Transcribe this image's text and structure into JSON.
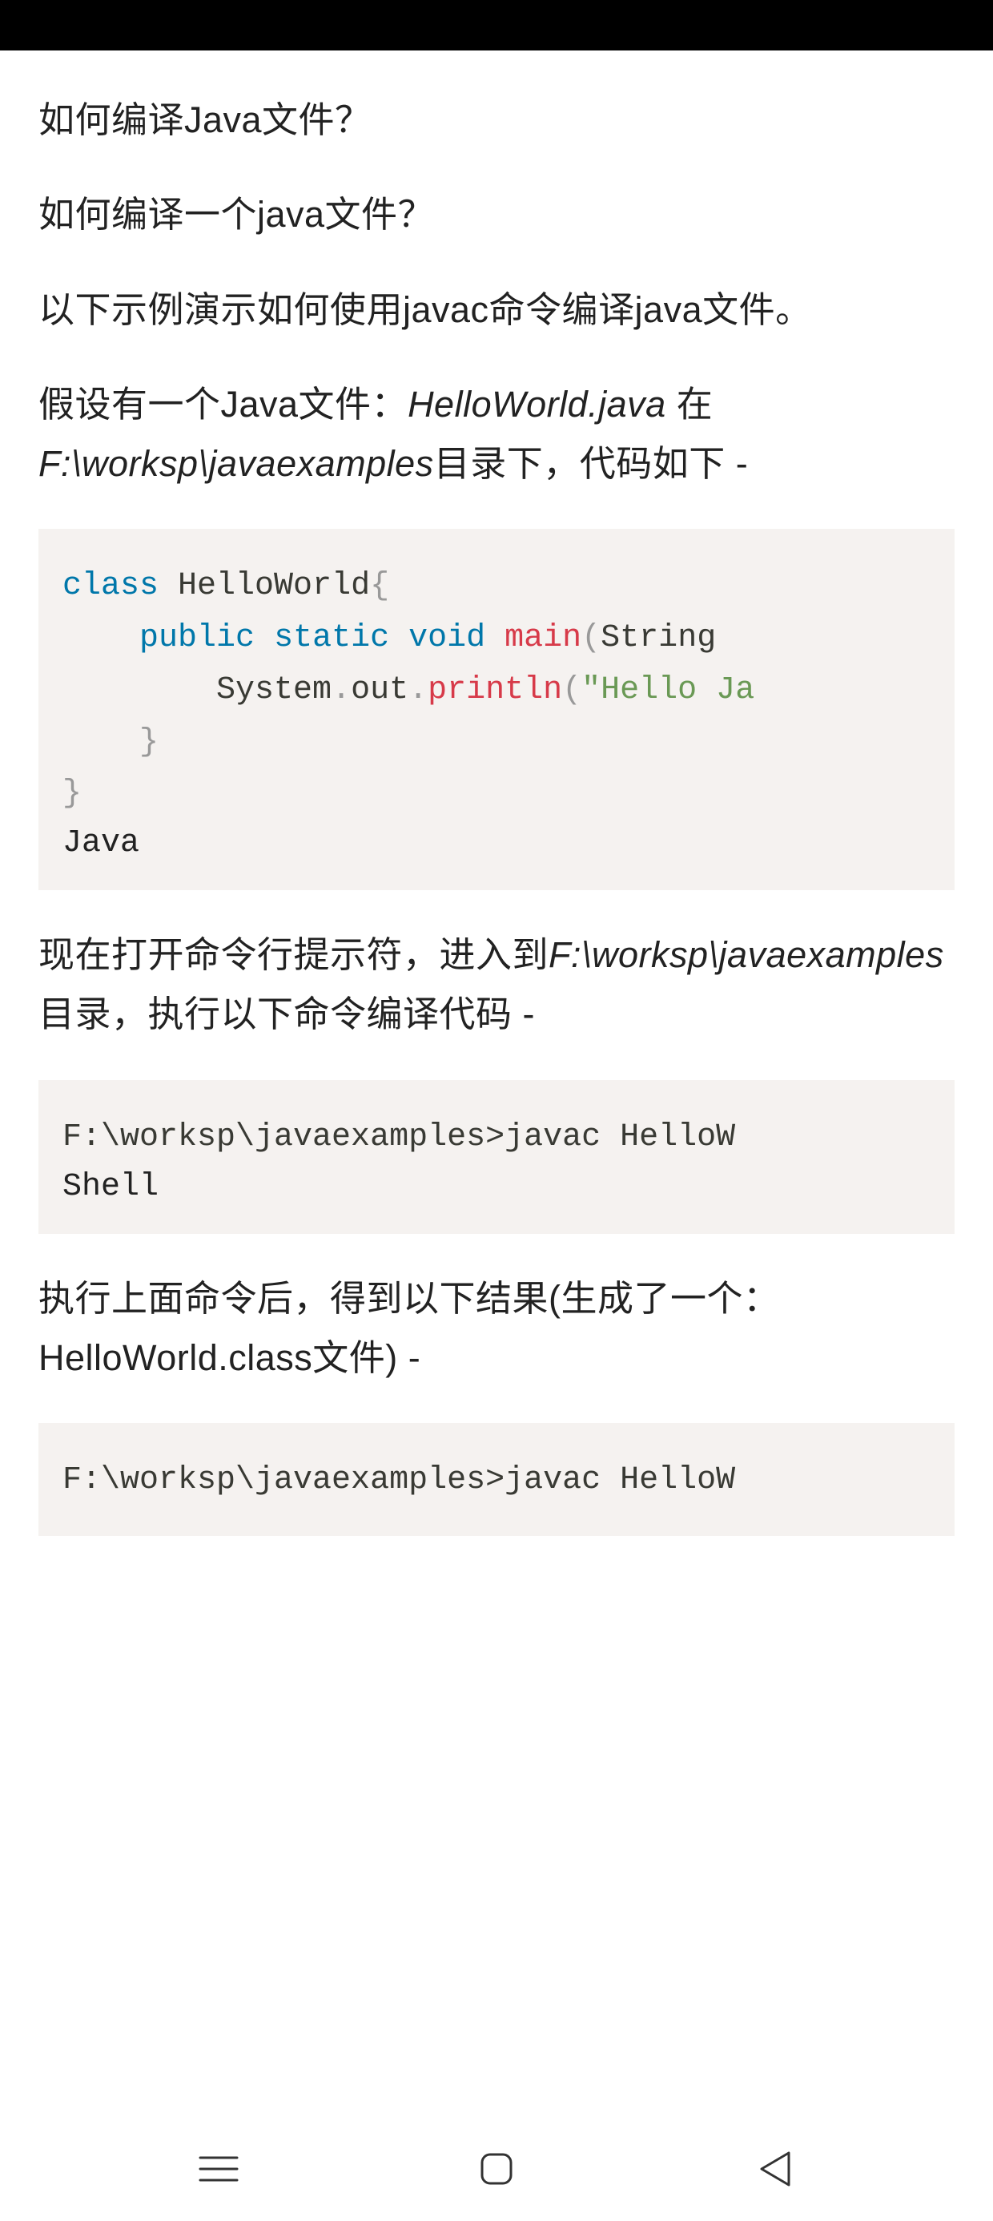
{
  "paragraphs": {
    "p1": "如何编译Java文件？",
    "p2": "如何编译一个java文件？",
    "p3": "以下示例演示如何使用javac命令编译java文件。",
    "p4_pre": "假设有一个Java文件：",
    "p4_em1": "HelloWorld.java",
    "p4_mid": " 在 ",
    "p4_em2": "F:\\worksp\\javaexamples",
    "p4_post": "目录下，代码如下 -",
    "p5_pre": "现在打开命令行提示符，进入到",
    "p5_em": "F:\\worksp\\javaexamples",
    "p5_post": "目录，执行以下命令编译代码 -",
    "p6": "执行上面命令后，得到以下结果(生成了一个：HelloWorld.class文件) -"
  },
  "code1": {
    "lang": "Java",
    "tokens": {
      "kw_class": "class",
      "cls_name": " HelloWorld",
      "lbrace": "{",
      "kw_public": "public",
      "kw_static": "static",
      "kw_void": "void",
      "fn_main": "main",
      "lparen": "(",
      "type_string": "String ",
      "sys": "        System",
      "dot1": ".",
      "out": "out",
      "dot2": ".",
      "println": "println",
      "lparen2": "(",
      "str": "\"Hello Ja",
      "rbrace1": "    }",
      "rbrace2": "}"
    }
  },
  "code2": {
    "lang": "Shell",
    "line": "F:\\worksp\\javaexamples>javac HelloW"
  },
  "code3": {
    "line": "F:\\worksp\\javaexamples>javac HelloW"
  }
}
